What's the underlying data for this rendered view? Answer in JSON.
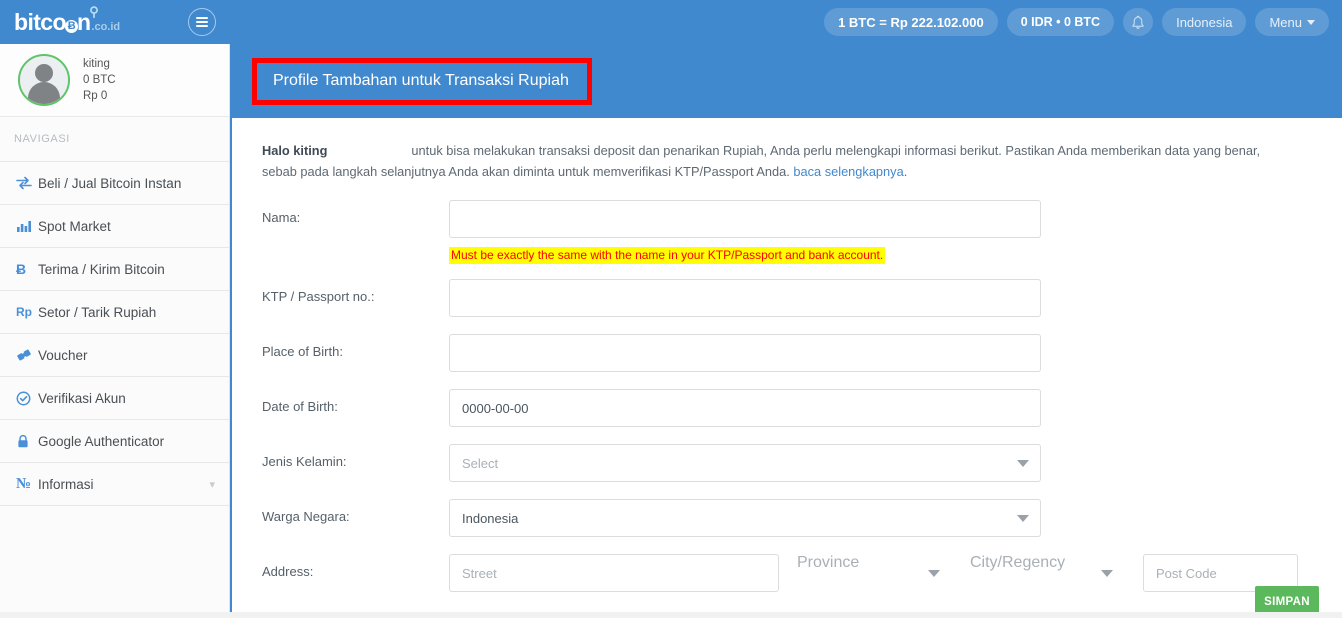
{
  "topbar": {
    "logo": {
      "main": "bitco",
      "glyph": "Ƀ",
      "after": "n",
      "tld": ".co.id",
      "key_icon": "key-icon"
    },
    "menu_toggle_icon": "hamburger-icon",
    "rate_pill": "1 BTC = Rp 222.102.000",
    "balance_pill": "0 IDR  •  0 BTC",
    "bell_icon": "🔔",
    "language": "Indonesia",
    "menu_label": "Menu"
  },
  "sidebar": {
    "profile": {
      "username": "kiting",
      "btc_balance": "0 BTC",
      "idr_balance": "Rp 0"
    },
    "nav_heading": "NAVIGASI",
    "items": [
      {
        "label": "Beli / Jual Bitcoin Instan",
        "icon": "exchange-arrows-icon"
      },
      {
        "label": "Spot Market",
        "icon": "bar-chart-icon"
      },
      {
        "label": "Terima / Kirim Bitcoin",
        "icon": "bitcoin-icon",
        "glyph": "Ƀ"
      },
      {
        "label": "Setor / Tarik Rupiah",
        "icon": "rupiah-icon",
        "glyph": "Rp"
      },
      {
        "label": "Voucher",
        "icon": "ticket-icon"
      },
      {
        "label": "Verifikasi Akun",
        "icon": "check-circle-icon"
      },
      {
        "label": "Google Authenticator",
        "icon": "lock-icon"
      },
      {
        "label": "Informasi",
        "icon": "info-icon",
        "chevron": "chevron-down-icon"
      }
    ]
  },
  "content": {
    "page_title": "Profile Tambahan untuk Transaksi Rupiah",
    "intro": {
      "greeting": "Halo kiting",
      "text_1": "untuk bisa melakukan transaksi deposit dan penarikan Rupiah, Anda perlu melengkapi informasi berikut. Pastikan Anda memberikan data yang benar, sebab pada langkah selanjutnya Anda akan diminta untuk memverifikasi KTP/Passport Anda.",
      "link": "baca selengkapnya",
      "period": "."
    },
    "form": {
      "nama": {
        "label": "Nama:",
        "value": "",
        "placeholder": "",
        "hint": "Must be exactly the same with the name in your KTP/Passport and bank account."
      },
      "ktp": {
        "label": "KTP / Passport no.:",
        "value": "",
        "placeholder": ""
      },
      "place_of_birth": {
        "label": "Place of Birth:",
        "value": "",
        "placeholder": ""
      },
      "date_of_birth": {
        "label": "Date of Birth:",
        "value": "0000-00-00",
        "placeholder": ""
      },
      "jenis_kelamin": {
        "label": "Jenis Kelamin:",
        "selected": "Select",
        "is_placeholder": true
      },
      "warga_negara": {
        "label": "Warga Negara:",
        "selected": "Indonesia",
        "is_placeholder": false
      },
      "address": {
        "label": "Address:",
        "street_placeholder": "Street",
        "street_value": "",
        "province": "Province",
        "city": "City/Regency",
        "post_code_placeholder": "Post Code",
        "post_code_value": ""
      },
      "save_label": "SIMPAN"
    }
  },
  "colors": {
    "brand_blue": "#4189ce",
    "accent_green": "#5cb85c",
    "annotation_red": "#ff0000",
    "highlight_yellow": "#ffff00"
  }
}
